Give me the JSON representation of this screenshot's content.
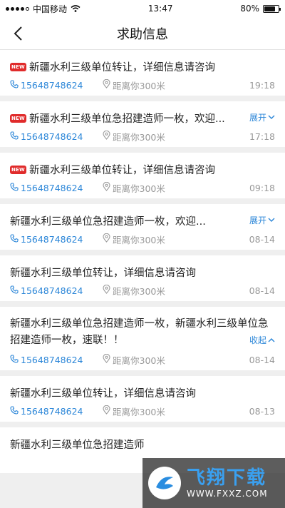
{
  "status_bar": {
    "carrier": "中国移动",
    "time": "13:47",
    "battery": "80%",
    "battery_level": 0.8
  },
  "nav": {
    "title": "求助信息",
    "back_icon": "chevron-left-icon"
  },
  "colors": {
    "accent": "#2b86d8",
    "new_badge": "#e02b2b",
    "muted": "#999999"
  },
  "new_badge_label": "NEW",
  "items": [
    {
      "is_new": true,
      "title": "新疆水利三级单位转让，详细信息请咨询",
      "toggle": "",
      "phone": "15648748624",
      "distance": "距离你300米",
      "time": "19:18"
    },
    {
      "is_new": true,
      "title": "新疆水利三级单位急招建造师一枚，欢迎...",
      "toggle": "展开",
      "phone": "15648748624",
      "distance": "距离你300米",
      "time": "17:18"
    },
    {
      "is_new": true,
      "title": "新疆水利三级单位转让，详细信息请咨询",
      "toggle": "",
      "phone": "15648748624",
      "distance": "距离你300米",
      "time": "09:18"
    },
    {
      "is_new": false,
      "title": "新疆水利三级单位急招建造师一枚，欢迎...",
      "toggle": "展开",
      "phone": "15648748624",
      "distance": "距离你300米",
      "time": "08-14"
    },
    {
      "is_new": false,
      "title": "新疆水利三级单位转让，详细信息请咨询",
      "toggle": "",
      "phone": "15648748624",
      "distance": "距离你300米",
      "time": "08-14"
    },
    {
      "is_new": false,
      "title": "新疆水利三级单位急招建造师一枚，新疆水利三级单位急招建造师一枚，速联！！",
      "toggle": "收起",
      "phone": "15648748624",
      "distance": "距离你300米",
      "time": "08-14"
    },
    {
      "is_new": false,
      "title": "新疆水利三级单位转让，详细信息请咨询",
      "toggle": "",
      "phone": "15648748624",
      "distance": "距离你300米",
      "time": "08-13"
    },
    {
      "is_new": false,
      "title": "新疆水利三级单位急招建造师",
      "toggle": "",
      "phone": "",
      "distance": "",
      "time": ""
    }
  ],
  "watermark": {
    "brand": "飞翔下载",
    "url": "WWW.FXXZ.COM"
  }
}
